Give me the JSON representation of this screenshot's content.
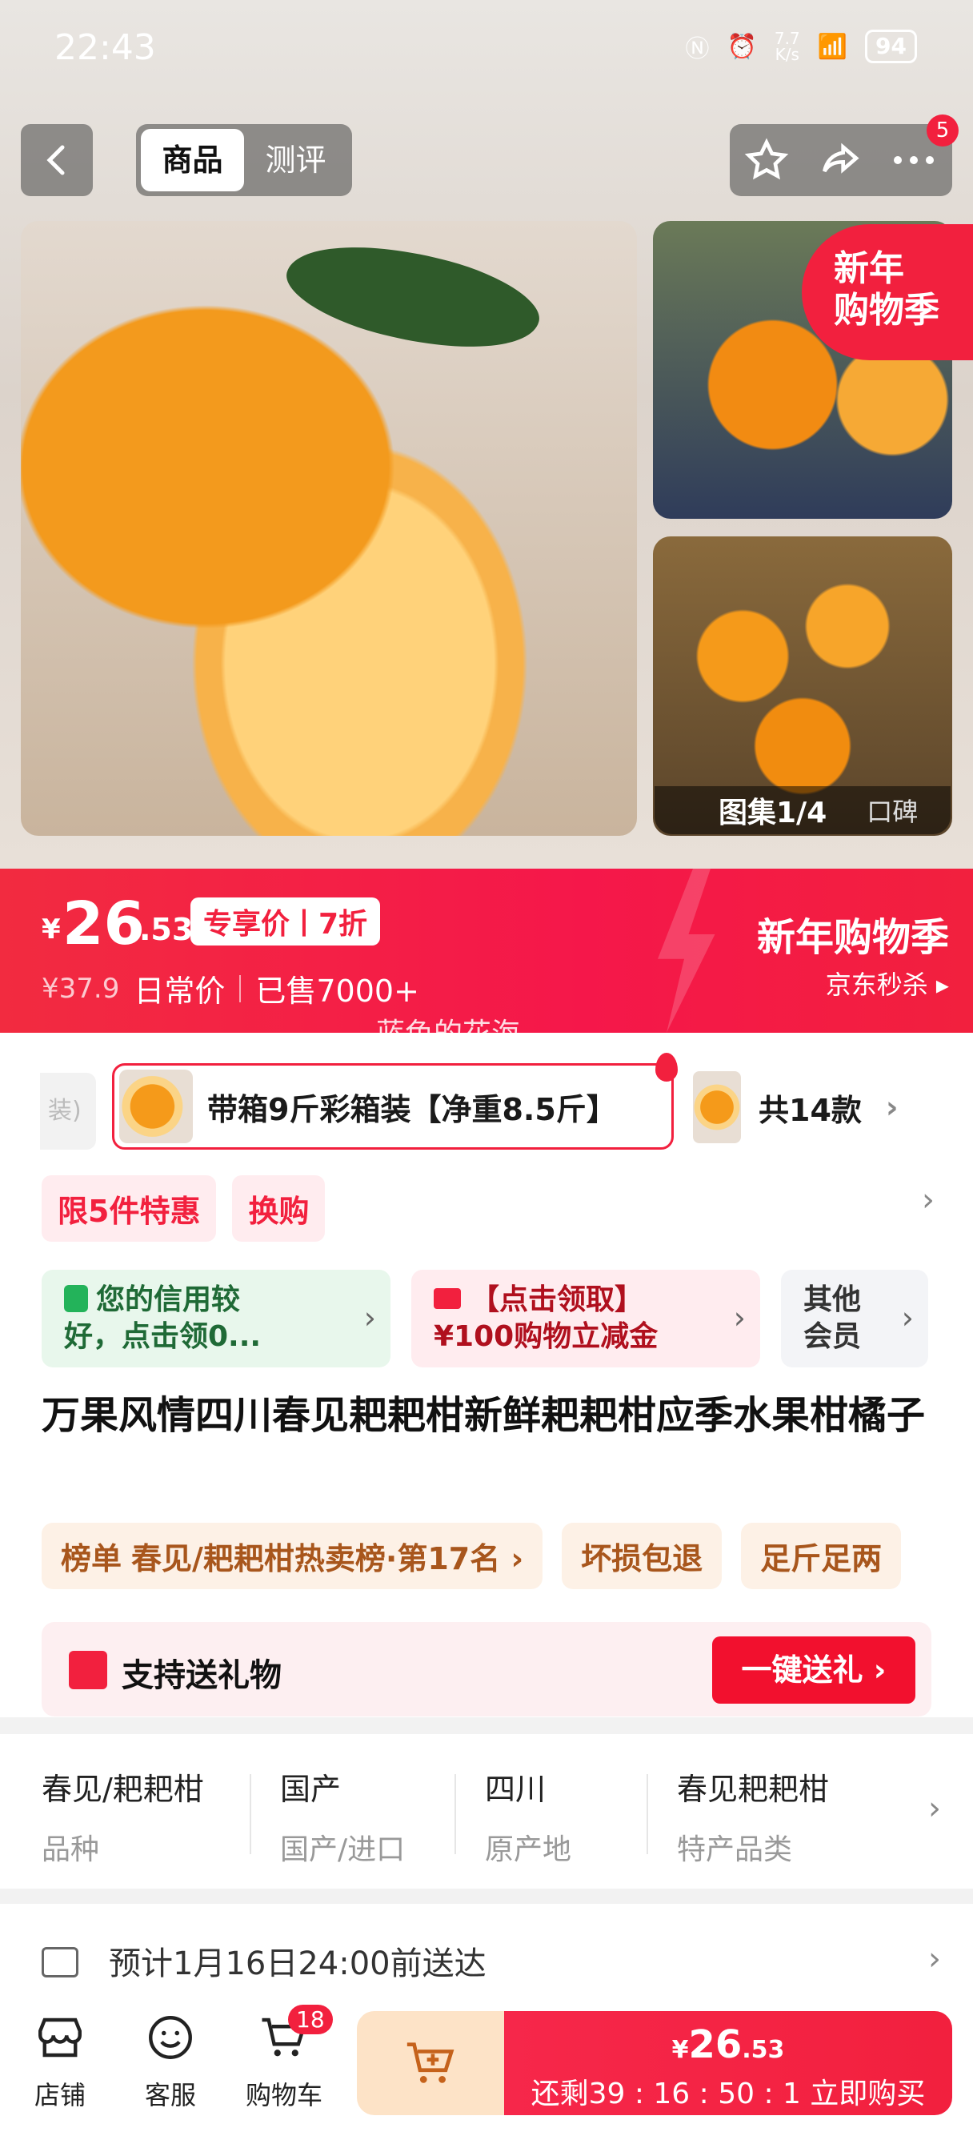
{
  "status": {
    "time": "22:43",
    "net_speed": "7.7\nK/s",
    "signal": "6",
    "battery": "94"
  },
  "nav": {
    "tabs": [
      "商品",
      "测评"
    ],
    "more_badge": "5"
  },
  "gallery": {
    "promo_corner": "新年\n购物季",
    "counter": "图集1/4",
    "reviews_tab": "口碑"
  },
  "price": {
    "currency": "¥",
    "integer": "26",
    "decimal": ".53",
    "tag": "专享价丨7折",
    "original": "¥37.9",
    "original_label": "日常价",
    "sold": "已售7000+",
    "promo_title": "新年购物季",
    "promo_sub": "京东秒杀 ▸"
  },
  "watermark": "蓝色的花海",
  "variants": {
    "stub": "装)",
    "selected": "带箱9斤彩箱装【净重8.5斤】",
    "count": "共14款"
  },
  "promo_chips": [
    "限5件特惠",
    "换购"
  ],
  "benefits": [
    {
      "text": "您的信用较\n好，点击领0..."
    },
    {
      "text": "【点击领取】\n¥100购物立减金"
    },
    {
      "text": "其他\n会员"
    }
  ],
  "product_title": "万果风情四川春见耙耙柑新鲜耙耙柑应季水果柑橘子",
  "tags": {
    "rank_head": "榜单",
    "rank_text": "春见/耙耙柑热卖榜·第17名 ›",
    "t2": "坏损包退",
    "t3": "足斤足两"
  },
  "gift": {
    "text": "支持送礼物",
    "button": "一键送礼 ›"
  },
  "attributes": [
    {
      "value": "春见/耙耙柑",
      "key": "品种"
    },
    {
      "value": "国产",
      "key": "国产/进口"
    },
    {
      "value": "四川",
      "key": "原产地"
    },
    {
      "value": "春见耙耙柑",
      "key": "特产品类"
    }
  ],
  "delivery": {
    "text": "预计1月16日24:00前送达"
  },
  "bottom": {
    "shop": "店铺",
    "service": "客服",
    "cart": "购物车",
    "cart_badge": "18",
    "buy_price_yen": "¥",
    "buy_price_int": "26",
    "buy_price_dec": ".53",
    "countdown": "还剩39 : 16 : 50 : 1  立即购买"
  },
  "colors": {
    "accent": "#f2203e",
    "green": "#23b35a",
    "tag_brown": "#a8561c"
  }
}
